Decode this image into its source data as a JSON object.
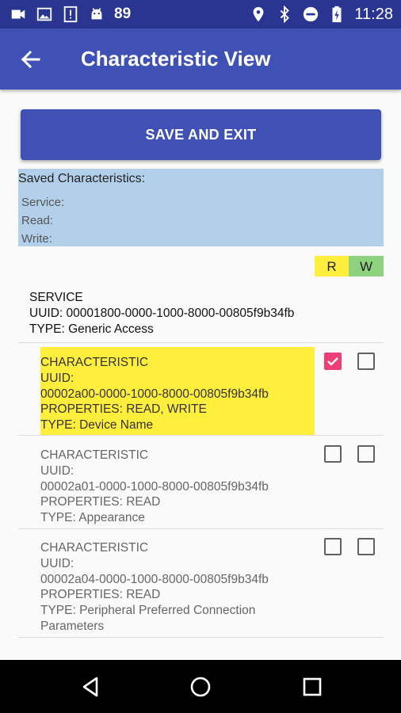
{
  "status_bar": {
    "notification_count": "89",
    "time": "11:28",
    "left_icons": [
      "video-camera-icon",
      "image-icon",
      "alert-icon",
      "android-icon"
    ],
    "right_icons": [
      "location-icon",
      "bluetooth-icon",
      "do-not-disturb-icon",
      "battery-charging-icon"
    ]
  },
  "app_bar": {
    "title": "Characteristic View",
    "back_icon": "arrow-back-icon"
  },
  "save_button": {
    "label": "SAVE AND EXIT"
  },
  "saved": {
    "title": "Saved Characteristics:",
    "service_label": "Service:",
    "read_label": "Read:",
    "write_label": "Write:"
  },
  "rw_header": {
    "read": "R",
    "write": "W"
  },
  "service": {
    "heading": "SERVICE",
    "uuid_line": "UUID: 00001800-0000-1000-8000-00805f9b34fb",
    "type_line": "TYPE: Generic Access"
  },
  "characteristics": [
    {
      "heading": "CHARACTERISTIC",
      "uuid_label": "UUID:",
      "uuid": "00002a00-0000-1000-8000-00805f9b34fb",
      "properties": "PROPERTIES: READ, WRITE",
      "type_lines": [
        "TYPE: Device Name"
      ],
      "read_checked": true,
      "write_checked": false,
      "highlighted": true
    },
    {
      "heading": "CHARACTERISTIC",
      "uuid_label": "UUID:",
      "uuid": "00002a01-0000-1000-8000-00805f9b34fb",
      "properties": "PROPERTIES: READ",
      "type_lines": [
        "TYPE: Appearance"
      ],
      "read_checked": false,
      "write_checked": false,
      "highlighted": false
    },
    {
      "heading": "CHARACTERISTIC",
      "uuid_label": "UUID:",
      "uuid": "00002a04-0000-1000-8000-00805f9b34fb",
      "properties": "PROPERTIES: READ",
      "type_lines": [
        "TYPE: Peripheral Preferred Connection",
        "Parameters"
      ],
      "read_checked": false,
      "write_checked": false,
      "highlighted": false
    }
  ],
  "nav_bar": {
    "icons": [
      "back-triangle-icon",
      "home-circle-icon",
      "recents-square-icon"
    ]
  },
  "colors": {
    "status_bar": "#2a3591",
    "primary": "#3f51b5",
    "saved_box": "#b2d0ea",
    "read_highlight": "#ffee3b",
    "write_highlight": "#8ed17f",
    "checkbox_checked": "#ed3f76"
  }
}
